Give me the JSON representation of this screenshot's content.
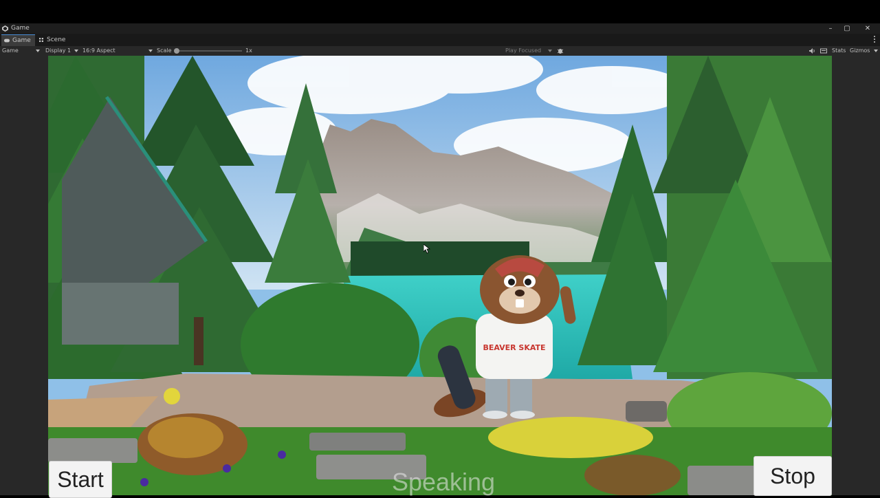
{
  "window": {
    "title": "Game",
    "icon": "unity-icon"
  },
  "window_controls": [
    {
      "name": "minimize-icon",
      "glyph": "–"
    },
    {
      "name": "maximize-icon",
      "glyph": "▢"
    },
    {
      "name": "close-icon",
      "glyph": "✕"
    }
  ],
  "tabs": [
    {
      "label": "Game",
      "icon": "gamepad-icon",
      "active": true
    },
    {
      "label": "Scene",
      "icon": "grid-icon",
      "active": false
    }
  ],
  "toolbar": {
    "view_mode": "Game",
    "display": "Display 1",
    "aspect": "16:9 Aspect",
    "scale_label": "Scale",
    "scale_value": "1x",
    "play_mode": "Play Focused",
    "stats_label": "Stats",
    "gizmos_label": "Gizmos"
  },
  "game": {
    "start_label": "Start",
    "stop_label": "Stop",
    "status_text": "Speaking",
    "character_shirt_text": "BEAVER SKATE"
  },
  "colors": {
    "accent": "#4a90d9",
    "lake": "#2fc7c0",
    "cap": "#b84a40",
    "fur": "#8a5530"
  }
}
